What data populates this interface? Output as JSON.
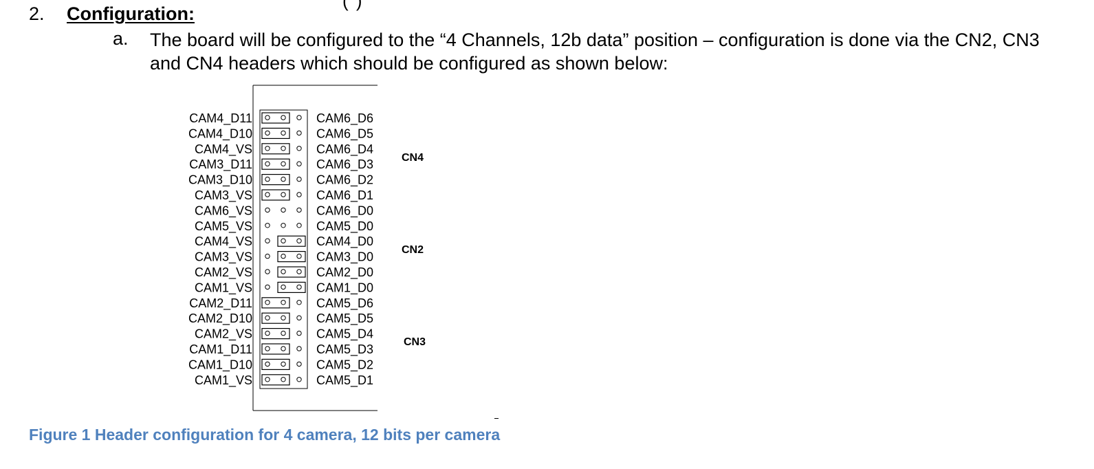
{
  "section": {
    "number": "2.",
    "title": "Configuration:",
    "fragment_top": "(                  )"
  },
  "item": {
    "letter": "a.",
    "text": "The board will be configured to the “4 Channels, 12b data” position – configuration is done via the CN2, CN3 and CN4 headers which should be configured as shown below:"
  },
  "diagram": {
    "header_groups": [
      "CN4",
      "CN2",
      "CN3"
    ],
    "rows": [
      {
        "left": "CAM4_D11",
        "right": "CAM6_D6",
        "jumper": "left"
      },
      {
        "left": "CAM4_D10",
        "right": "CAM6_D5",
        "jumper": "left"
      },
      {
        "left": "CAM4_VS",
        "right": "CAM6_D4",
        "jumper": "left"
      },
      {
        "left": "CAM3_D11",
        "right": "CAM6_D3",
        "jumper": "left"
      },
      {
        "left": "CAM3_D10",
        "right": "CAM6_D2",
        "jumper": "left"
      },
      {
        "left": "CAM3_VS",
        "right": "CAM6_D1",
        "jumper": "left"
      },
      {
        "left": "CAM6_VS",
        "right": "CAM6_D0",
        "jumper": "none"
      },
      {
        "left": "CAM5_VS",
        "right": "CAM5_D0",
        "jumper": "none"
      },
      {
        "left": "CAM4_VS",
        "right": "CAM4_D0",
        "jumper": "right"
      },
      {
        "left": "CAM3_VS",
        "right": "CAM3_D0",
        "jumper": "right"
      },
      {
        "left": "CAM2_VS",
        "right": "CAM2_D0",
        "jumper": "right"
      },
      {
        "left": "CAM1_VS",
        "right": "CAM1_D0",
        "jumper": "right"
      },
      {
        "left": "CAM2_D11",
        "right": "CAM5_D6",
        "jumper": "left"
      },
      {
        "left": "CAM2_D10",
        "right": "CAM5_D5",
        "jumper": "left"
      },
      {
        "left": "CAM2_VS",
        "right": "CAM5_D4",
        "jumper": "left"
      },
      {
        "left": "CAM1_D11",
        "right": "CAM5_D3",
        "jumper": "left"
      },
      {
        "left": "CAM1_D10",
        "right": "CAM5_D2",
        "jumper": "left"
      },
      {
        "left": "CAM1_VS",
        "right": "CAM5_D1",
        "jumper": "left"
      }
    ]
  },
  "caption": "Figure 1  Header configuration for 4 camera, 12 bits per camera"
}
